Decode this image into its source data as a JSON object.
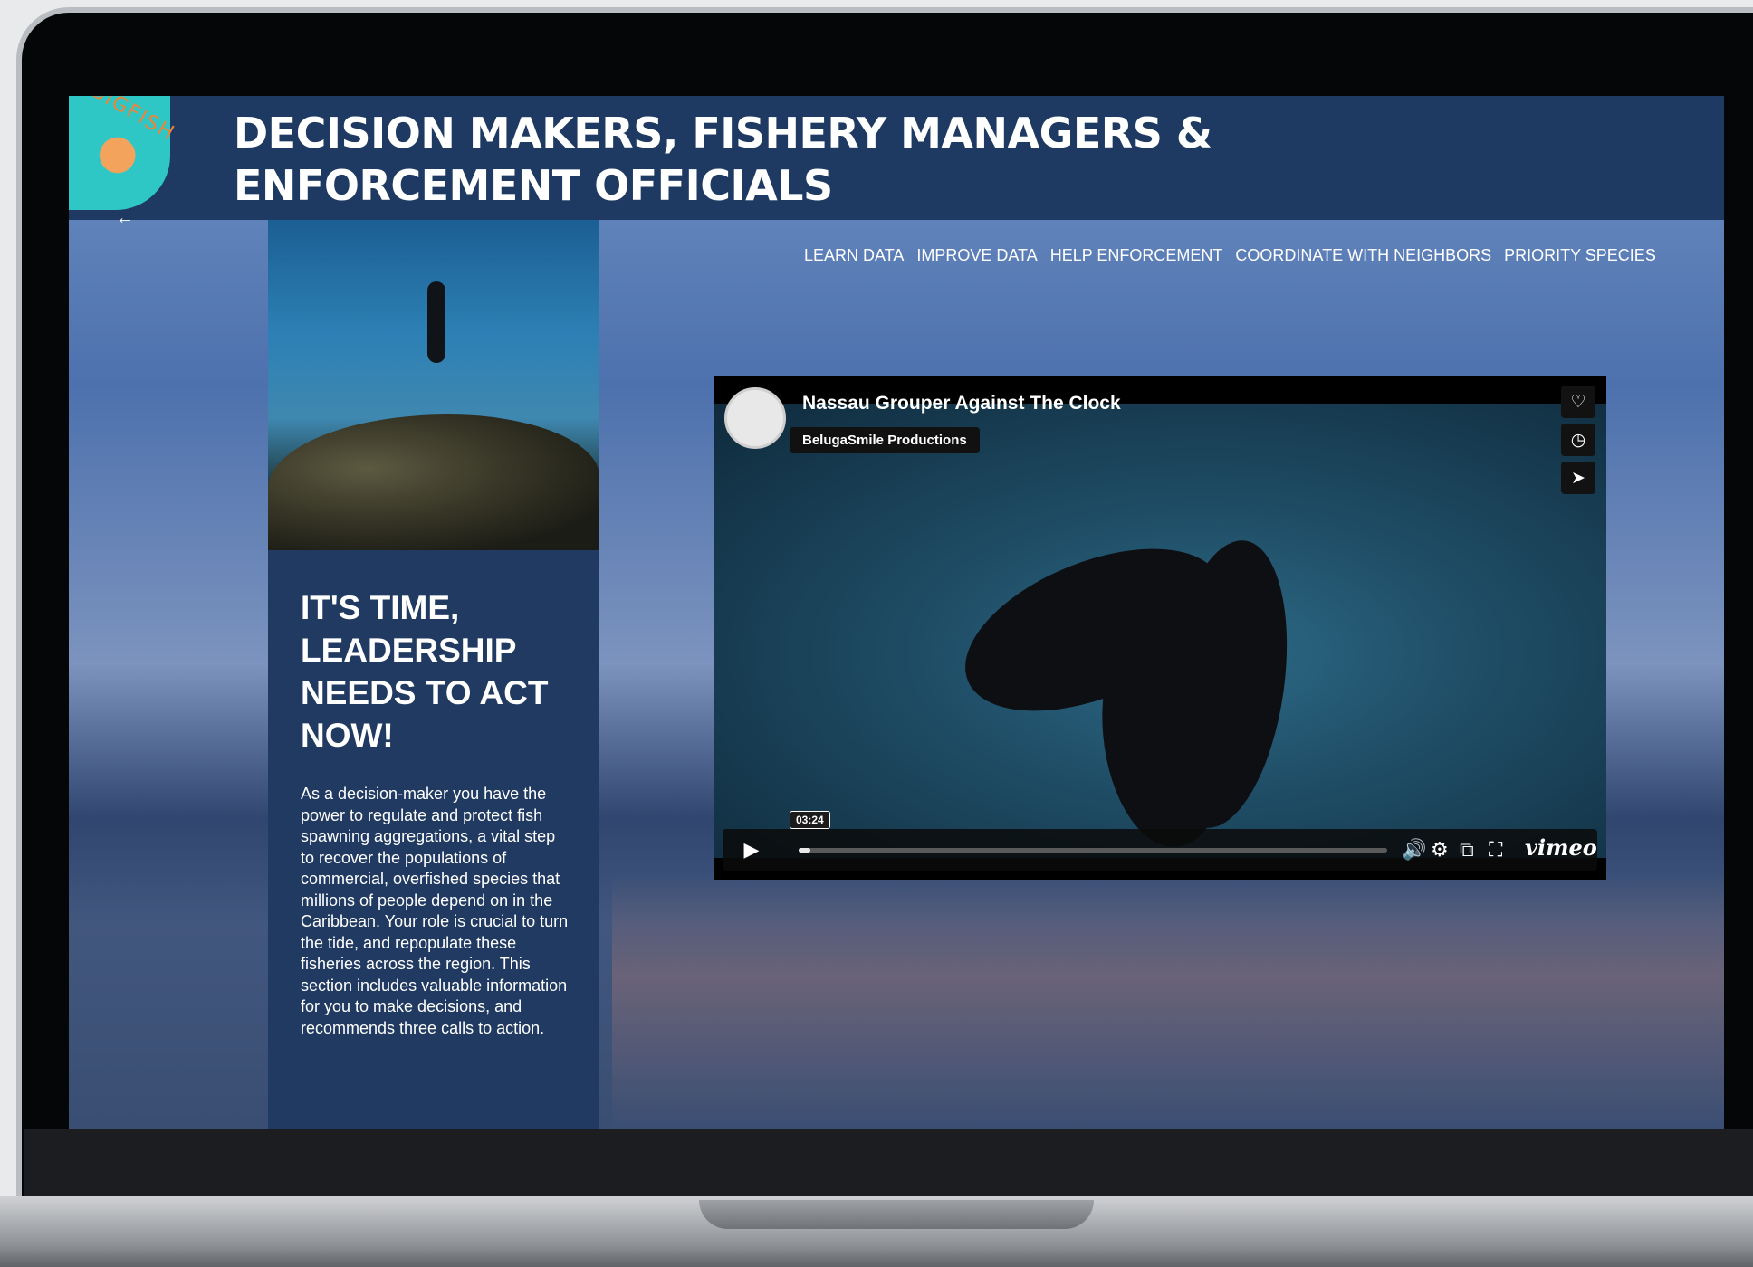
{
  "header": {
    "title": "DECISION MAKERS, FISHERY MANAGERS & ENFORCEMENT OFFICIALS",
    "logo_text": "BIGFISH",
    "back_arrow": "←"
  },
  "nav": {
    "items": [
      "LEARN DATA",
      "IMPROVE DATA",
      "HELP ENFORCEMENT",
      "COORDINATE WITH NEIGHBORS",
      "PRIORITY SPECIES"
    ]
  },
  "side_panel": {
    "heading": "IT'S TIME, LEADERSHIP NEEDS TO ACT NOW!",
    "body": "As a decision-maker you have the power to regulate and protect fish spawning aggregations, a vital step to recover the populations of commercial, overfished species that millions of people depend on in the Caribbean. Your role is crucial to turn the tide, and repopulate these fisheries across the region. This section includes valuable information for you to make decisions, and recommends three calls to action."
  },
  "video": {
    "title": "Nassau Grouper Against The Clock",
    "owner": "BelugaSmile Productions",
    "timecode": "03:24",
    "progress": 0.02,
    "brand": "vimeo",
    "icons": {
      "like": "heart-icon",
      "watch_later": "clock-icon",
      "share": "paper-plane-icon",
      "play": "play-icon",
      "volume": "volume-icon",
      "settings": "gear-icon",
      "pip": "picture-in-picture-icon",
      "fullscreen": "fullscreen-icon"
    }
  },
  "colors": {
    "header_bg": "#1e3a63",
    "panel_bg": "#213a61",
    "text": "#ffffff",
    "logo_teal": "#2fc7c6",
    "logo_orange": "#e9863c"
  }
}
